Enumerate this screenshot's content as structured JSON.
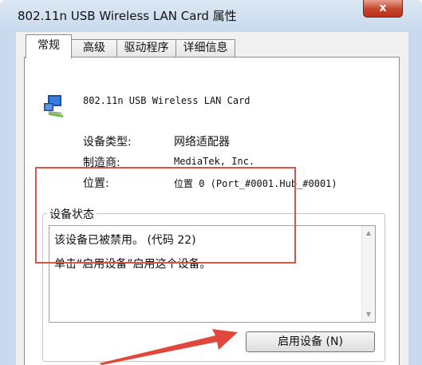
{
  "window": {
    "title": "802.11n USB Wireless LAN Card 属性",
    "close_label": "x"
  },
  "tabs": [
    {
      "label": "常规",
      "active": true
    },
    {
      "label": "高级",
      "active": false
    },
    {
      "label": "驱动程序",
      "active": false
    },
    {
      "label": "详细信息",
      "active": false
    }
  ],
  "device": {
    "name": "802.11n USB Wireless LAN Card",
    "icon": "network-adapter-icon"
  },
  "properties": [
    {
      "label": "设备类型:",
      "value": "网络适配器"
    },
    {
      "label": "制造商:",
      "value": "MediaTek, Inc."
    },
    {
      "label": "位置:",
      "value": "位置 0 (Port_#0001.Hub_#0001)"
    }
  ],
  "status_group": {
    "legend": "设备状态",
    "lines": [
      "该设备已被禁用。 (代码 22)",
      "单击“启用设备”启用这个设备。"
    ]
  },
  "enable_button": {
    "label": "启用设备 (N)"
  },
  "colors": {
    "highlight_box": "#d9534a",
    "arrow": "#e0483c",
    "close_button": "#c7432b"
  }
}
